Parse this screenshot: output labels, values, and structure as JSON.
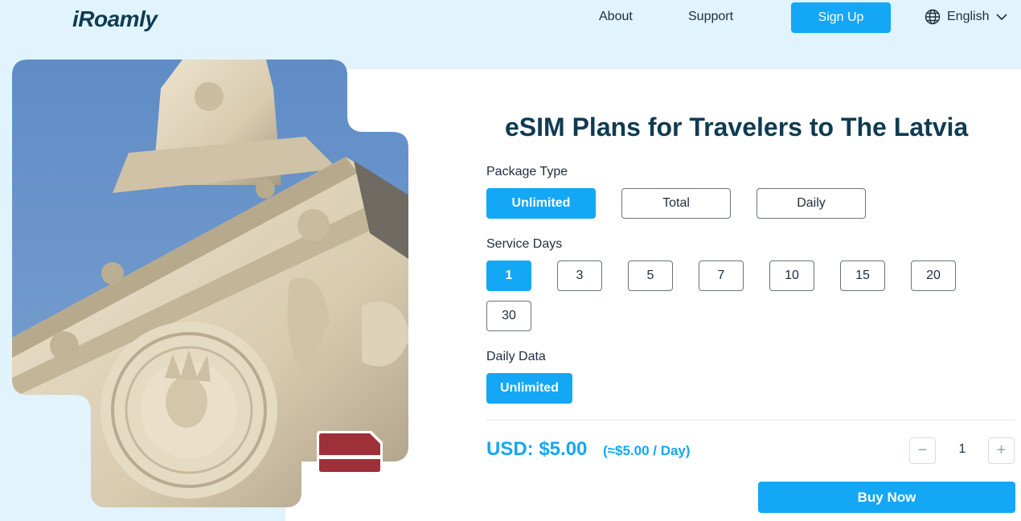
{
  "header": {
    "logo": "iRoamly",
    "nav": {
      "about": "About",
      "support": "Support"
    },
    "signup_label": "Sign Up",
    "language": "English"
  },
  "hero": {
    "image_subject": "Ornate Art Nouveau building facade with medallion face against blue sky",
    "flag": "Latvia"
  },
  "main": {
    "title": "eSIM Plans for Travelers to The Latvia",
    "package_type": {
      "label": "Package Type",
      "options": [
        "Unlimited",
        "Total",
        "Daily"
      ],
      "selected": "Unlimited"
    },
    "service_days": {
      "label": "Service Days",
      "options": [
        "1",
        "3",
        "5",
        "7",
        "10",
        "15",
        "20",
        "30"
      ],
      "selected": "1"
    },
    "daily_data": {
      "label": "Daily Data",
      "options": [
        "Unlimited"
      ],
      "selected": "Unlimited"
    },
    "price": "USD: $5.00",
    "per_day": "(≈$5.00 / Day)",
    "quantity": {
      "minus": "−",
      "value": "1",
      "plus": "+"
    },
    "buy_label": "Buy Now"
  },
  "colors": {
    "accent": "#14a7f5",
    "header_bg": "#e1f3fc",
    "title": "#0f3b52",
    "flag_red": "#9e3039"
  }
}
